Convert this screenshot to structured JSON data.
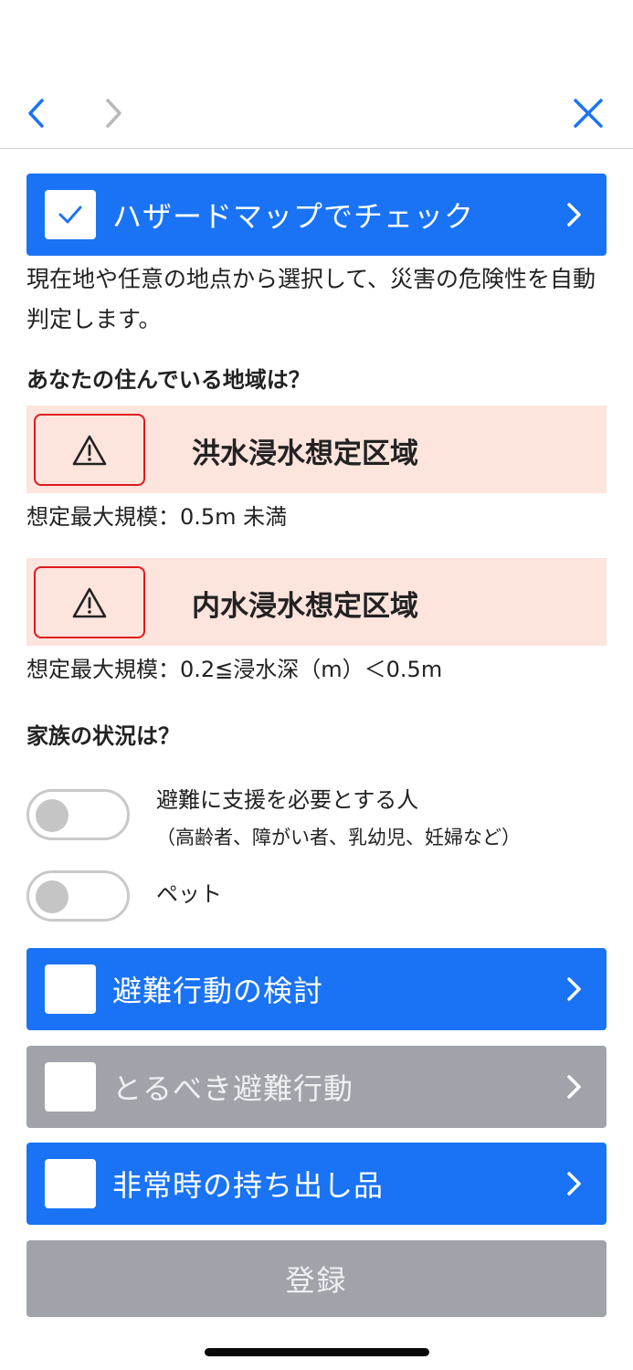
{
  "nav": {
    "back_icon": "chevron-left-icon",
    "forward_icon": "chevron-right-icon",
    "close_icon": "close-icon"
  },
  "hazard_check": {
    "label": "ハザードマップでチェック",
    "checked": true,
    "description": "現在地や任意の地点から選択して、災害の危険性を自動判定します。"
  },
  "area": {
    "question": "あなたの住んでいる地域は？",
    "zones": [
      {
        "name": "洪水浸水想定区域",
        "scale": "想定最大規模：0.5m 未満",
        "icon": "warning-icon"
      },
      {
        "name": "内水浸水想定区域",
        "scale": "想定最大規模：0.2≦浸水深（m）＜0.5m",
        "icon": "warning-icon"
      }
    ]
  },
  "family": {
    "question": "家族の状況は？",
    "toggles": [
      {
        "label": "避難に支援を必要とする人",
        "sublabel": "（高齢者、障がい者、乳幼児、妊婦など）",
        "on": false
      },
      {
        "label": "ペット",
        "on": false
      }
    ]
  },
  "steps": [
    {
      "label": "避難行動の検討",
      "enabled": true,
      "checked": false
    },
    {
      "label": "とるべき避難行動",
      "enabled": false,
      "checked": false
    },
    {
      "label": "非常時の持ち出し品",
      "enabled": true,
      "checked": false
    }
  ],
  "register_label": "登録",
  "colors": {
    "primary": "#1a73f5",
    "disabled": "#a0a4aa",
    "zone_bg": "#fde4dd",
    "zone_border": "#e0191e"
  }
}
